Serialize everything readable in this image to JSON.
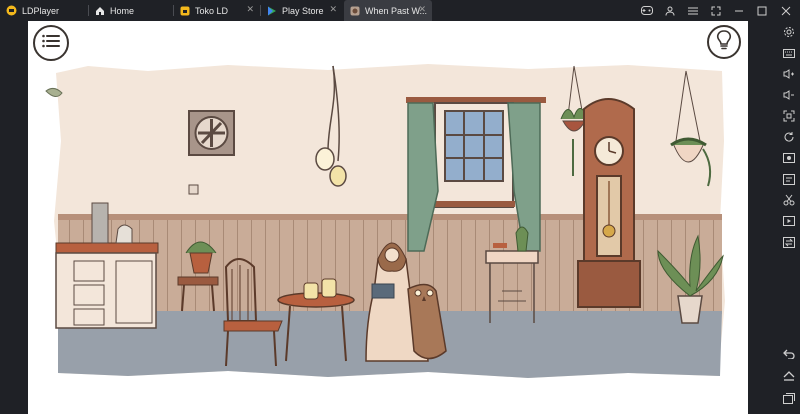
{
  "tabs": [
    {
      "label": "LDPlayer",
      "icon": "ldplayer-logo-icon"
    },
    {
      "label": "Home",
      "icon": "home-icon"
    },
    {
      "label": "Toko LD",
      "icon": "store-icon"
    },
    {
      "label": "Play Store",
      "icon": "play-store-icon"
    },
    {
      "label": "When Past W...",
      "icon": "game-icon"
    }
  ],
  "window_controls": [
    "gamepad-icon",
    "account-icon",
    "menu-icon",
    "fullscreen-icon",
    "minimize-icon",
    "maximize-icon",
    "close-icon"
  ],
  "sidebar_icons": [
    "settings-icon",
    "keyboard-icon",
    "volume-up-icon",
    "volume-down-icon",
    "screenshot-icon",
    "rotate-icon",
    "record-icon",
    "apk-icon",
    "scissors-icon",
    "video-icon",
    "sync-icon",
    "back-icon",
    "home-icon",
    "recent-apps-icon"
  ],
  "colors": {
    "frame": "#1f2126",
    "active_tab": "#3a3c42",
    "wall": "#f3e6da",
    "wainscot": "#c9ac98",
    "floor": "#98a0aa",
    "curtain": "#7fa08a",
    "wood": "#9a5a40"
  }
}
